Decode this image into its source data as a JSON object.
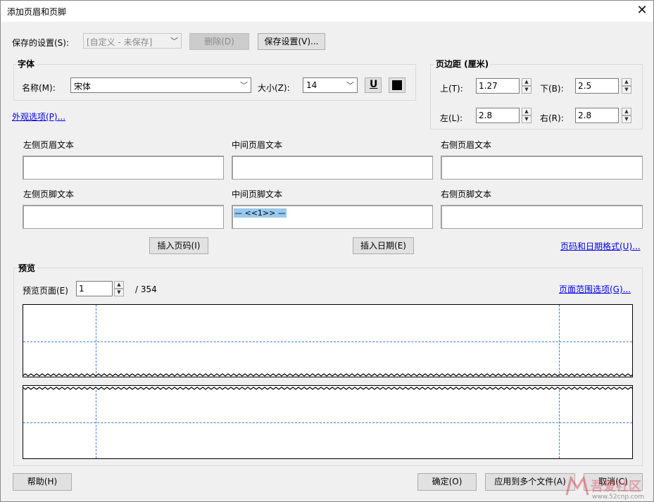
{
  "window": {
    "title": "添加页眉和页脚",
    "close_glyph": "✕"
  },
  "saved_settings": {
    "label": "保存的设置(S):",
    "value": "[自定义 - 未保存]",
    "delete_label": "删除(D)",
    "save_label": "保存设置(V)..."
  },
  "font": {
    "group_title": "字体",
    "name_label": "名称(M):",
    "name_value": "宋体",
    "size_label": "大小(Z):",
    "size_value": "14",
    "underline_glyph": "U",
    "color": "#000000"
  },
  "margins": {
    "group_title": "页边距 (厘米)",
    "top_label": "上(T):",
    "top_value": "1.27",
    "bottom_label": "下(B):",
    "bottom_value": "2.5",
    "left_label": "左(L):",
    "left_value": "2.8",
    "right_label": "右(R):",
    "right_value": "2.8"
  },
  "appearance_link": "外观选项(P)...",
  "header_footer": {
    "left_header_label": "左侧页眉文本",
    "center_header_label": "中间页眉文本",
    "right_header_label": "右侧页眉文本",
    "left_footer_label": "左侧页脚文本",
    "center_footer_label": "中间页脚文本",
    "right_footer_label": "右侧页脚文本",
    "center_footer_value": "— <<1>> —"
  },
  "insert": {
    "page_number_label": "插入页码(I)",
    "date_label": "插入日期(E)",
    "format_link": "页码和日期格式(U)..."
  },
  "preview": {
    "group_title": "预览",
    "page_label": "预览页面(E)",
    "page_value": "1",
    "total": "/ 354",
    "range_link": "页面范围选项(G)..."
  },
  "footer_buttons": {
    "help_label": "帮助(H)",
    "ok_label": "确定(O)",
    "apply_label": "应用到多个文件(A)",
    "cancel_label": "取消(C)"
  },
  "watermark": {
    "text": "吾爱社区",
    "url": "www.52cnp.com"
  },
  "colors": {
    "link": "#0000ee",
    "guide": "#3b7cd6",
    "selection": "#99c9ef"
  }
}
